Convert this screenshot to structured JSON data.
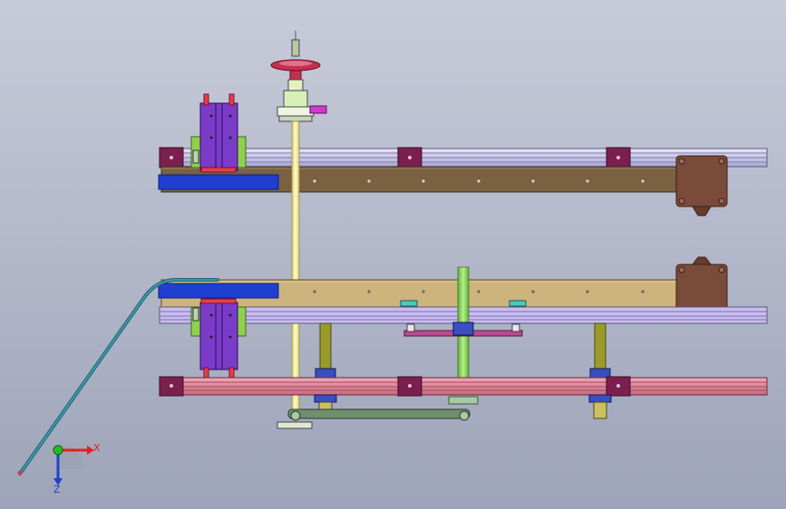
{
  "viewport": {
    "background_top": "#c8ccd9",
    "background_bottom": "#9ea4b9"
  },
  "triad": {
    "x_label": "X",
    "z_label": "Z",
    "x_color": "#e02020",
    "y_color": "#20c020",
    "z_color": "#2040d0"
  },
  "colors": {
    "upper_plate": "#7a6142",
    "lower_plate": "#cdb47c",
    "rail_light": "#c3c2ea",
    "rail_lilac": "#b9a8e8",
    "rail_pink": "#df8aa0",
    "connector": "#7a1f4e",
    "blue_bar": "#1f3fd0",
    "motor": "#7a4a3a",
    "shaft_yellow": "#f5f0a0",
    "green_shaft": "#86d15b",
    "slide_purple": "#7a3cc8",
    "slide_green": "#8fd14f",
    "handwheel": "#c0324f",
    "bearing_blue": "#3a4fbf",
    "link_green": "#6f8f6f",
    "cable": "#1f6a7a"
  }
}
